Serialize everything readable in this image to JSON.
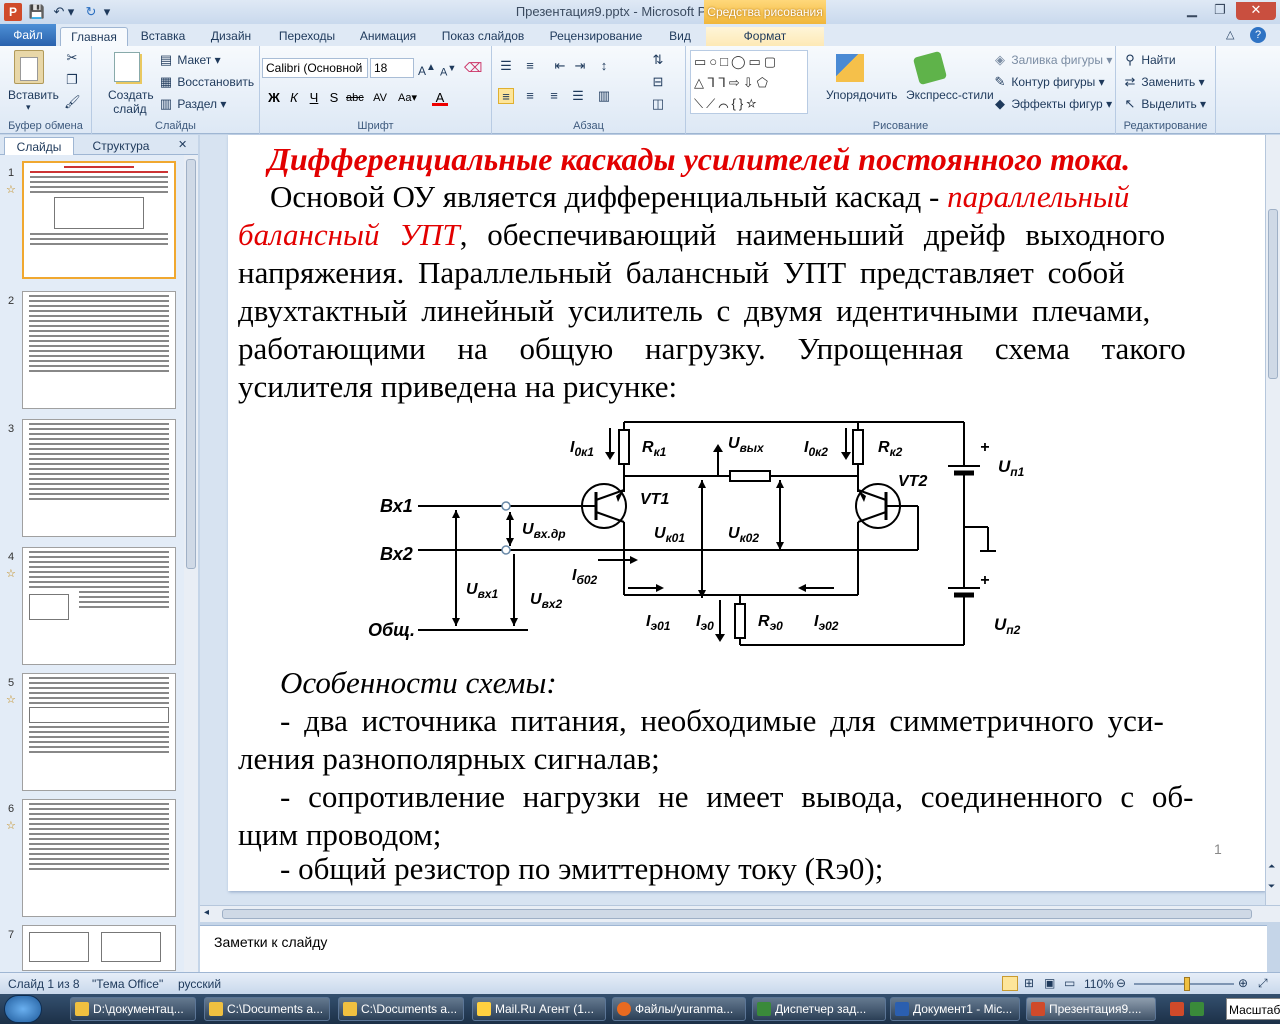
{
  "window": {
    "title": "Презентация9.pptx - Microsoft PowerPoint",
    "context_tab": "Средства рисования"
  },
  "tabs": [
    "Файл",
    "Главная",
    "Вставка",
    "Дизайн",
    "Переходы",
    "Анимация",
    "Показ слайдов",
    "Рецензирование",
    "Вид",
    "Формат"
  ],
  "ribbon": {
    "clipboard": {
      "paste": "Вставить",
      "label": "Буфер обмена"
    },
    "slides": {
      "new_slide": "Создать слайд",
      "layout": "Макет",
      "reset": "Восстановить",
      "section": "Раздел",
      "label": "Слайды"
    },
    "font": {
      "name": "Calibri (Основной",
      "size": "18",
      "label": "Шрифт"
    },
    "paragraph": {
      "label": "Абзац"
    },
    "drawing": {
      "arrange": "Упорядочить",
      "quick_styles": "Экспресс-стили",
      "fill": "Заливка фигуры",
      "outline": "Контур фигуры",
      "effects": "Эффекты фигур",
      "label": "Рисование"
    },
    "editing": {
      "find": "Найти",
      "replace": "Заменить",
      "select": "Выделить",
      "label": "Редактирование"
    }
  },
  "left_panel": {
    "tab_slides": "Слайды",
    "tab_outline": "Структура",
    "slide_numbers": [
      "1",
      "2",
      "3",
      "4",
      "5",
      "6",
      "7"
    ]
  },
  "slide": {
    "heading": "Дифференциальные каскады усилителей постоянного тока.",
    "p1_a": "Основой ОУ является дифференциальный каскад - ",
    "p1_red1": "параллельный",
    "p2_red": "балансный УПТ",
    "p2_b": ", обеспечивающий наименьший дрейф выходного",
    "p3": "напряжения. Параллельный балансный УПТ представляет собой",
    "p4": "двухтактный линейный усилитель с двумя идентичными плечами,",
    "p5": "работающими на общую нагрузку. Упрощенная схема такого",
    "p6": "усилителя приведена на рисунке:",
    "features_title": "Особенности схемы:",
    "f1a": "- два источника питания, необходимые для симметричного уси-",
    "f1b": "ления разнополярных сигналав;",
    "f2a": "- сопротивление нагрузки не имеет вывода, соединенного с об-",
    "f2b": "щим проводом;",
    "f3": "- общий резистор по эмиттерному току (Rэ0);",
    "page_number": "1"
  },
  "circuit_labels": {
    "in1": "Вх1",
    "in2": "Вх2",
    "common": "Общ.",
    "vt1": "VT1",
    "vt2": "VT2",
    "plus1": "+",
    "plus2": "+"
  },
  "notes": {
    "placeholder": "Заметки к слайду"
  },
  "status": {
    "slide": "Слайд 1 из 8",
    "theme": "\"Тема Office\"",
    "lang": "русский",
    "zoom": "110%"
  },
  "taskbar": [
    {
      "label": "D:\\документац..."
    },
    {
      "label": "C:\\Documents a..."
    },
    {
      "label": "C:\\Documents a..."
    },
    {
      "label": "Mail.Ru Агент (1..."
    },
    {
      "label": "Файлы/yuranma..."
    },
    {
      "label": "Диспетчер зад..."
    },
    {
      "label": "Документ1 - Mic..."
    },
    {
      "label": "Презентация9...."
    }
  ],
  "tray": {
    "lang": "Масштаб"
  }
}
